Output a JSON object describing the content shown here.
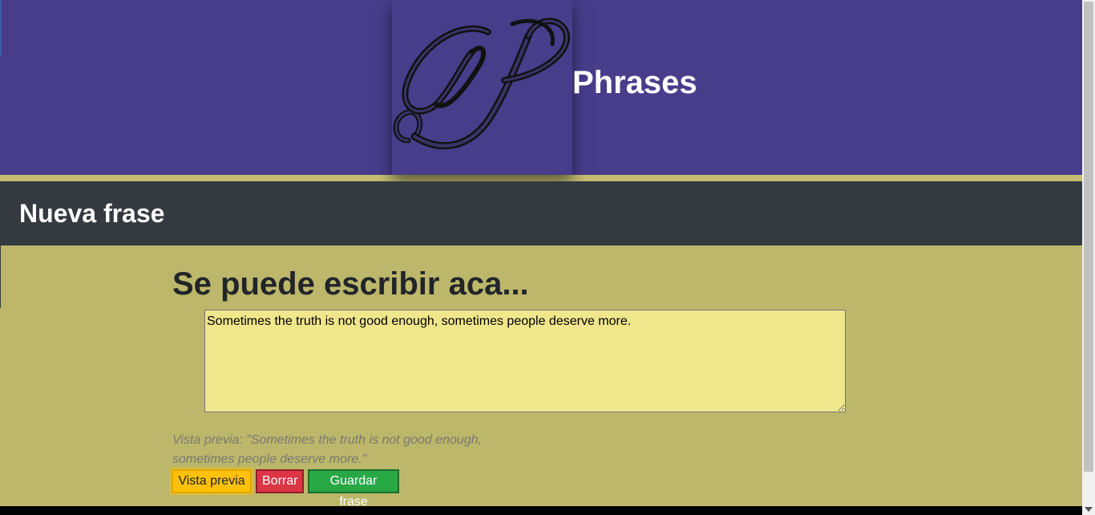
{
  "header": {
    "brand_title": "Phrases",
    "logo_letter_icon": "script-p-logo-icon"
  },
  "section": {
    "title": "Nueva frase"
  },
  "content": {
    "heading": "Se puede escribir aca...",
    "textarea_value": "Sometimes the truth is not good enough, sometimes people deserve more.",
    "preview_text": "Vista previa: \"Sometimes the truth is not good enough, sometimes people deserve more.\""
  },
  "buttons": {
    "preview_label": "Vista previa",
    "clear_label": "Borrar",
    "save_label": "Guardar frase"
  },
  "colors": {
    "header_bg": "#483d8b",
    "section_bar": "#343a40",
    "page_bg": "#bcb76b",
    "textarea_bg": "#f0e68c",
    "warning": "#ffc107",
    "danger": "#dc3545",
    "success": "#28a745"
  }
}
